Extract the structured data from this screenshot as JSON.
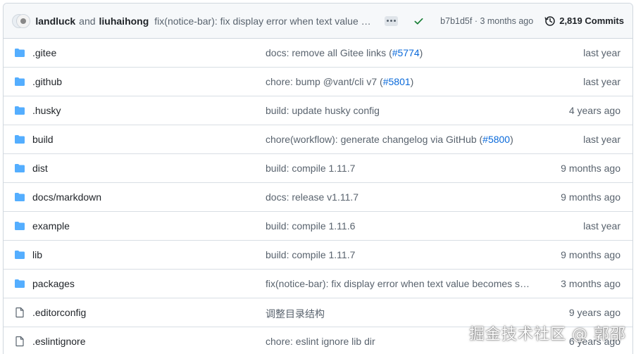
{
  "header": {
    "author1": "landluck",
    "and": "and",
    "author2": "liuhaihong",
    "commit_message": "fix(notice-bar): fix display error when text value becomes short",
    "commit_meta": "b7b1d5f · 3 months ago",
    "commits_label": "2,819 Commits"
  },
  "files": [
    {
      "type": "folder",
      "name": ".gitee",
      "msg": "docs: remove all Gitee links (",
      "link": "#5774",
      "msg_end": ")",
      "age": "last year"
    },
    {
      "type": "folder",
      "name": ".github",
      "msg": "chore: bump @vant/cli v7 (",
      "link": "#5801",
      "msg_end": ")",
      "age": "last year"
    },
    {
      "type": "folder",
      "name": ".husky",
      "msg": "build: update husky config",
      "link": "",
      "msg_end": "",
      "age": "4 years ago"
    },
    {
      "type": "folder",
      "name": "build",
      "msg": "chore(workflow): generate changelog via GitHub (",
      "link": "#5800",
      "msg_end": ")",
      "age": "last year"
    },
    {
      "type": "folder",
      "name": "dist",
      "msg": "build: compile 1.11.7",
      "link": "",
      "msg_end": "",
      "age": "9 months ago"
    },
    {
      "type": "folder",
      "name": "docs/markdown",
      "msg": "docs: release v1.11.7",
      "link": "",
      "msg_end": "",
      "age": "9 months ago"
    },
    {
      "type": "folder",
      "name": "example",
      "msg": "build: compile 1.11.6",
      "link": "",
      "msg_end": "",
      "age": "last year"
    },
    {
      "type": "folder",
      "name": "lib",
      "msg": "build: compile 1.11.7",
      "link": "",
      "msg_end": "",
      "age": "9 months ago"
    },
    {
      "type": "folder",
      "name": "packages",
      "msg": "fix(notice-bar): fix display error when text value becomes sh...",
      "link": "",
      "msg_end": "",
      "age": "3 months ago"
    },
    {
      "type": "file",
      "name": ".editorconfig",
      "msg": "调整目录结构",
      "link": "",
      "msg_end": "",
      "age": "9 years ago"
    },
    {
      "type": "file",
      "name": ".eslintignore",
      "msg": "chore: eslint ignore lib dir",
      "link": "",
      "msg_end": "",
      "age": "6 years ago"
    }
  ],
  "watermark": "掘金技术社区 @ 郭邵",
  "colors": {
    "folder": "#54aeff",
    "link": "#0969da",
    "success": "#1a7f37",
    "muted": "#59636e"
  },
  "icons": {
    "folder": "folder-icon",
    "file": "file-icon",
    "check": "check-icon",
    "history": "history-icon",
    "ellipsis": "ellipsis-icon"
  }
}
